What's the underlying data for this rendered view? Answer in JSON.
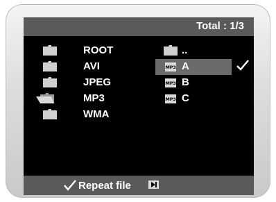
{
  "header": {
    "total": "Total : 1/3"
  },
  "left_panel": {
    "items": [
      {
        "label": "ROOT",
        "icon": "folder-icon",
        "open": false
      },
      {
        "label": "AVI",
        "icon": "folder-icon",
        "open": false
      },
      {
        "label": "JPEG",
        "icon": "folder-icon",
        "open": false
      },
      {
        "label": "MP3",
        "icon": "folder-open-icon",
        "open": true
      },
      {
        "label": "WMA",
        "icon": "folder-icon",
        "open": false
      }
    ]
  },
  "right_panel": {
    "items": [
      {
        "label": "..",
        "icon": "folder-icon"
      },
      {
        "label": "A",
        "icon": "mp3-file-icon",
        "badge": "MP3",
        "selected": true,
        "checked": true
      },
      {
        "label": "B",
        "icon": "mp3-file-icon",
        "badge": "MP3"
      },
      {
        "label": "C",
        "icon": "mp3-file-icon",
        "badge": "MP3"
      }
    ]
  },
  "footer": {
    "repeat_label": "Repeat file",
    "repeat_checked": true,
    "next_icon": "skip-next-icon"
  },
  "colors": {
    "bar": "#5a5a5a",
    "highlight": "#6a6a6a",
    "screen": "#000000",
    "text": "#ffffff"
  }
}
